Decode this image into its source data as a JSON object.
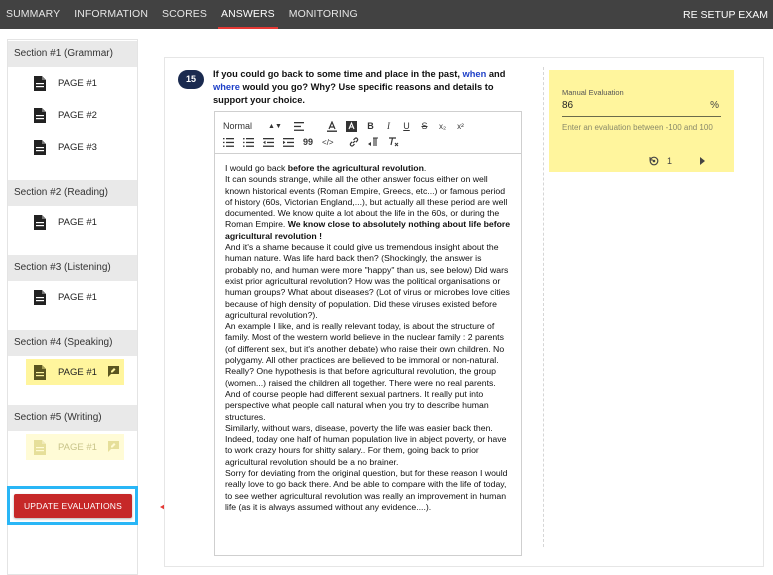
{
  "topnav": {
    "tabs": [
      {
        "label": "SUMMARY"
      },
      {
        "label": "INFORMATION"
      },
      {
        "label": "SCORES"
      },
      {
        "label": "ANSWERS"
      },
      {
        "label": "MONITORING"
      }
    ],
    "active_tab": "ANSWERS",
    "right_action": "RE SETUP EXAM"
  },
  "sidebar": {
    "sections": [
      {
        "title": "Section #1 (Grammar)",
        "pages": [
          "PAGE #1",
          "PAGE #2",
          "PAGE #3"
        ]
      },
      {
        "title": "Section #2 (Reading)",
        "pages": [
          "PAGE #1"
        ]
      },
      {
        "title": "Section #3 (Listening)",
        "pages": [
          "PAGE #1"
        ]
      },
      {
        "title": "Section #4 (Speaking)",
        "pages": [
          "PAGE #1"
        ]
      },
      {
        "title": "Section #5 (Writing)",
        "pages": [
          "PAGE #1"
        ]
      }
    ],
    "update_button": "UPDATE EVALUATIONS"
  },
  "question": {
    "number": "15",
    "text_before": "If you could go back to some time and place in the past, ",
    "kw1": "when",
    "text_and": " and ",
    "kw2": "where",
    "text_after": " would you go? Why? Use specific reasons and details to support your choice."
  },
  "editor": {
    "toolbar": {
      "style_select": "Normal",
      "row1": [
        "align-icon",
        "text-color-icon",
        "highlight-icon",
        "B",
        "I",
        "U",
        "S",
        "x₂",
        "x²"
      ],
      "row2": [
        "ordered-list-icon",
        "bullet-list-icon",
        "outdent-icon",
        "indent-icon",
        "99",
        "</>",
        "link-icon",
        "rtl-icon",
        "clear-format-icon"
      ]
    },
    "answer": {
      "p1a": "I would go back ",
      "p1b": "before the agricultural revolution",
      "p1c": ".",
      "p2a": "It can sounds strange, while all the other answer focus either on well known historical events (Roman Empire, Greecs, etc...) or famous period of history (60s, Victorian England,...), but actually all these period are well documented. We know quite a lot about the life in the 60s, or during the Roman Empire. ",
      "p2b": "We know close to absolutely nothing about life before agricultural revolution !",
      "p3": "And it's a shame because it could give us tremendous insight about the human nature. Was life hard back then? (Shockingly, the answer is probably no, and human were more \"happy\" than us, see below) Did wars exist prior agricultural revolution? How was the political organisations or human groups? What about diseases? (Lot of virus or microbes love cities because of high density of population. Did these viruses existed before agricultural revolution?).",
      "p4": "An example I like, and is really relevant today, is about the structure of family. Most of the western world believe in the nuclear family : 2 parents (of different sex, but it's another debate) who raise their own children. No polygamy. All other practices are believed to be immoral or non-natural. Really? One hypothesis is that before agricultural revolution, the group (women...) raised the children all together. There were no real parents. And of course people had different sexual partners. It really put into perspective what people call natural when you try to describe human structures.",
      "p5": "Similarly, without wars, disease, poverty the life was easier back then. Indeed, today one half of human population live in abject poverty, or have to work crazy hours for shitty salary.. For them, going back to prior agricultural revolution should be a no brainer.",
      "p6": "Sorry for deviating from the original question, but for these reason I would really love to go back there. And be able to compare with the life of today, to see wether agricultural revolution was really an improvement in human life (as it is always assumed without any evidence....)."
    }
  },
  "manual_evaluation": {
    "label": "Manual Evaluation",
    "value": "86",
    "unit": "%",
    "hint": "Enter an evaluation between -100 and 100",
    "page": "1",
    "highlight_color": "#fff59d"
  },
  "colors": {
    "accent": "#c62828",
    "focus_outline": "#29b6f6",
    "question_badge": "#1a2a4f",
    "keyword": "#1e40c8",
    "arrow": "#e53935"
  }
}
